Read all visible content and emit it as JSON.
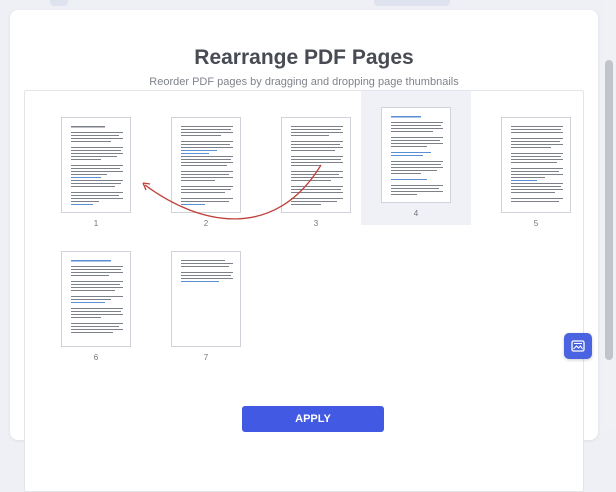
{
  "header": {
    "title": "Rearrange PDF Pages",
    "subtitle": "Reorder PDF pages by dragging and dropping page thumbnails"
  },
  "pages": [
    {
      "number": "1",
      "selected": false
    },
    {
      "number": "2",
      "selected": false
    },
    {
      "number": "3",
      "selected": false
    },
    {
      "number": "4",
      "selected": true
    },
    {
      "number": "5",
      "selected": false
    },
    {
      "number": "6",
      "selected": false
    },
    {
      "number": "7",
      "selected": false
    }
  ],
  "actions": {
    "apply_label": "APPLY"
  },
  "colors": {
    "accent": "#4159e3",
    "drag_arrow": "#c0403a",
    "selected_bg": "#eff1f6"
  },
  "icons": {
    "fab": "image-icon"
  }
}
